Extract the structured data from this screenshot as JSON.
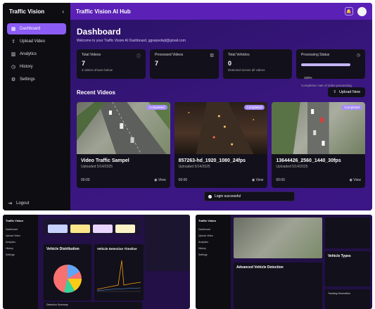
{
  "sidebar": {
    "brand": "Traffic Vision",
    "items": [
      {
        "label": "Dashboard",
        "icon": "dashboard-icon"
      },
      {
        "label": "Upload Video",
        "icon": "upload-icon"
      },
      {
        "label": "Analytics",
        "icon": "analytics-icon"
      },
      {
        "label": "History",
        "icon": "history-icon"
      },
      {
        "label": "Settings",
        "icon": "gear-icon"
      }
    ],
    "logout": "Logout"
  },
  "header": {
    "title": "Traffic Vision AI Hub"
  },
  "dashboard": {
    "title": "Dashboard",
    "welcome": "Welcome to your Traffic Vision AI Dashboard, ggsepedwjt@gmail.com"
  },
  "stats": [
    {
      "label": "Total Videos",
      "value": "7",
      "note": "3 videos shown below"
    },
    {
      "label": "Processed Videos",
      "value": "7",
      "note": ""
    },
    {
      "label": "Total Vehicles",
      "value": "0",
      "note": "Detected across all videos"
    },
    {
      "label": "Processing Status",
      "value": "",
      "note": "Completion rate of video processing",
      "percent": "100%",
      "progress": 1.0
    }
  ],
  "recent": {
    "title": "Recent Videos",
    "upload_label": "Upload New"
  },
  "videos": [
    {
      "title": "Video Traffic Sampel",
      "uploaded": "Uploaded 5/14/2025",
      "duration": "00:00",
      "status": "Completed",
      "view": "View"
    },
    {
      "title": "857263-hd_1920_1080_24fps",
      "uploaded": "Uploaded 5/14/2025",
      "duration": "00:00",
      "status": "Completed",
      "view": "View"
    },
    {
      "title": "13644426_2560_1440_30fps",
      "uploaded": "Uploaded 5/14/2025",
      "duration": "00:00",
      "status": "Completed",
      "view": "View"
    }
  ],
  "toast": "Login successful",
  "preview_a": {
    "brand": "Traffic Vision",
    "items": [
      "Dashboard",
      "Upload Video",
      "Analytics",
      "History",
      "Settings"
    ],
    "distribution": "Vehicle Distribution",
    "timeline": "Vehicle Detection Timeline",
    "summary": "Detection Summary"
  },
  "preview_b": {
    "brand": "Traffic Vision",
    "items": [
      "Dashboard",
      "Upload Video",
      "Analytics",
      "History",
      "Settings"
    ],
    "advanced": "Advanced Vehicle Detection",
    "types": "Vehicle Types",
    "tracking": "Tracking Information"
  }
}
